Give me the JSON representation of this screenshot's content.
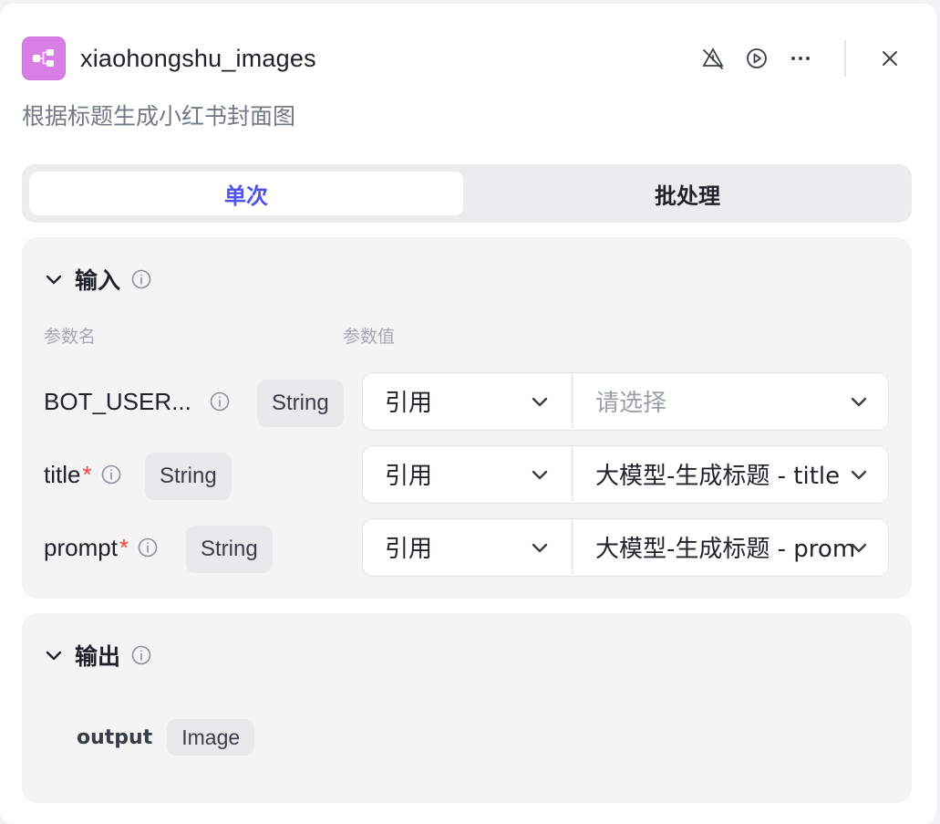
{
  "header": {
    "title": "xiaohongshu_images",
    "description": "根据标题生成小红书封面图",
    "icons": [
      "workflow-icon",
      "debug-off-icon",
      "run-icon",
      "more-icon",
      "close-icon"
    ]
  },
  "tabs": {
    "single": "单次",
    "batch": "批处理",
    "active": "single"
  },
  "input": {
    "title": "输入",
    "col_name": "参数名",
    "col_value": "参数值",
    "params": [
      {
        "name": "BOT_USER...",
        "required": false,
        "type": "String",
        "mode": "引用",
        "value": "请选择",
        "placeholder": true
      },
      {
        "name": "title",
        "required": true,
        "type": "String",
        "mode": "引用",
        "value": "大模型-生成标题 - title",
        "placeholder": false
      },
      {
        "name": "prompt",
        "required": true,
        "type": "String",
        "mode": "引用",
        "value": "大模型-生成标题 - prompt",
        "placeholder": false
      }
    ]
  },
  "output": {
    "title": "输出",
    "params": [
      {
        "name": "output",
        "type": "Image"
      }
    ]
  },
  "colors": {
    "accent": "#4d53e8",
    "app_icon": "#d97ee6",
    "required": "#f53f3f"
  }
}
